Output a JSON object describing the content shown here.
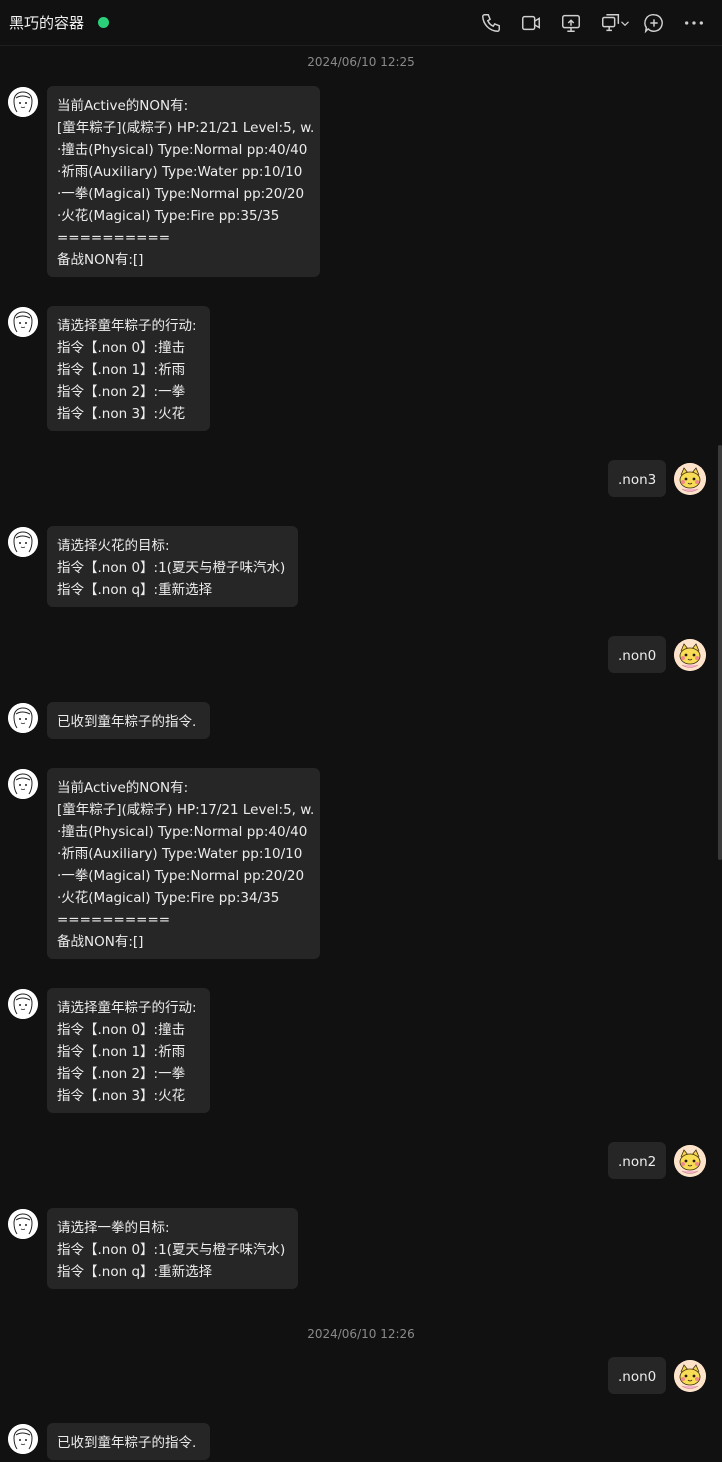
{
  "header": {
    "title": "黑巧的容器",
    "online_color": "#2bd17a",
    "icons": [
      "phone-icon",
      "video-icon",
      "screen-share-icon",
      "remote-desktop-icon",
      "add-icon",
      "more-icon"
    ]
  },
  "timestamps": [
    "2024/06/10 12:25",
    "2024/06/10 12:26"
  ],
  "status_block": {
    "header": "当前Active的NON有:",
    "footer_sep": "==========",
    "footer": "备战NON有:[]"
  },
  "messages": [
    {
      "side": "left",
      "lines": [
        "当前Active的NON有:",
        "[童年粽子](咸粽子) HP:21/21 Level:5, w.",
        "·撞击(Physical) Type:Normal pp:40/40",
        "·祈雨(Auxiliary) Type:Water pp:10/10",
        "·一拳(Magical) Type:Normal pp:20/20",
        "·火花(Magical) Type:Fire pp:35/35",
        "==========",
        "备战NON有:[]"
      ]
    },
    {
      "side": "left",
      "lines": [
        "请选择童年粽子的行动:",
        "指令【.non 0】:撞击",
        "指令【.non 1】:祈雨",
        "指令【.non 2】:一拳",
        "指令【.non 3】:火花"
      ]
    },
    {
      "side": "right",
      "lines": [
        ".non3"
      ]
    },
    {
      "side": "left",
      "lines": [
        "请选择火花的目标:",
        "指令【.non 0】:1(夏天与橙子味汽水)",
        "指令【.non q】:重新选择"
      ]
    },
    {
      "side": "right",
      "lines": [
        ".non0"
      ]
    },
    {
      "side": "left",
      "lines": [
        "已收到童年粽子的指令."
      ]
    },
    {
      "side": "left",
      "lines": [
        "当前Active的NON有:",
        "[童年粽子](咸粽子) HP:17/21 Level:5, w.",
        "·撞击(Physical) Type:Normal pp:40/40",
        "·祈雨(Auxiliary) Type:Water pp:10/10",
        "·一拳(Magical) Type:Normal pp:20/20",
        "·火花(Magical) Type:Fire pp:34/35",
        "==========",
        "备战NON有:[]"
      ]
    },
    {
      "side": "left",
      "lines": [
        "请选择童年粽子的行动:",
        "指令【.non 0】:撞击",
        "指令【.non 1】:祈雨",
        "指令【.non 2】:一拳",
        "指令【.non 3】:火花"
      ]
    },
    {
      "side": "right",
      "lines": [
        ".non2"
      ]
    },
    {
      "side": "left",
      "lines": [
        "请选择一拳的目标:",
        "指令【.non 0】:1(夏天与橙子味汽水)",
        "指令【.non q】:重新选择"
      ]
    },
    {
      "side": "right",
      "lines": [
        ".non0"
      ]
    },
    {
      "side": "left",
      "lines": [
        "已收到童年粽子的指令."
      ]
    }
  ]
}
